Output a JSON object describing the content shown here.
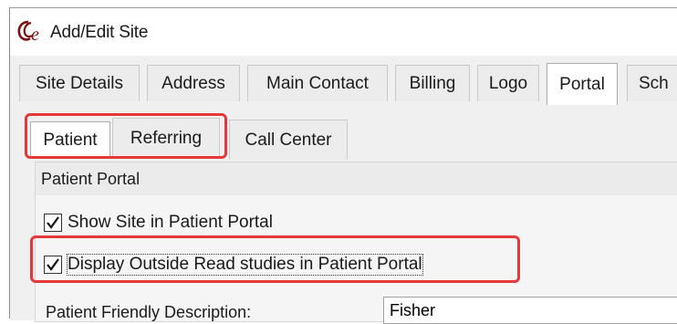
{
  "window": {
    "title": "Add/Edit Site",
    "icon": "app-logo-icon"
  },
  "main_tabs": [
    {
      "label": "Site Details",
      "active": false
    },
    {
      "label": "Address",
      "active": false
    },
    {
      "label": "Main Contact",
      "active": false
    },
    {
      "label": "Billing",
      "active": false
    },
    {
      "label": "Logo",
      "active": false
    },
    {
      "label": "Portal",
      "active": true
    },
    {
      "label": "Sch",
      "active": false
    }
  ],
  "sub_tabs": [
    {
      "label": "Patient",
      "active": true
    },
    {
      "label": "Referring",
      "active": false
    },
    {
      "label": "Call Center",
      "active": false
    }
  ],
  "panel": {
    "title": "Patient Portal",
    "options": [
      {
        "label": "Show Site in Patient Portal",
        "checked": true
      },
      {
        "label": "Display Outside Read studies in Patient Portal",
        "checked": true
      }
    ],
    "description_label": "Patient Friendly Description:",
    "description_value": "Fisher"
  },
  "colors": {
    "highlight": "#e5383b",
    "logo": "#7a1010"
  }
}
